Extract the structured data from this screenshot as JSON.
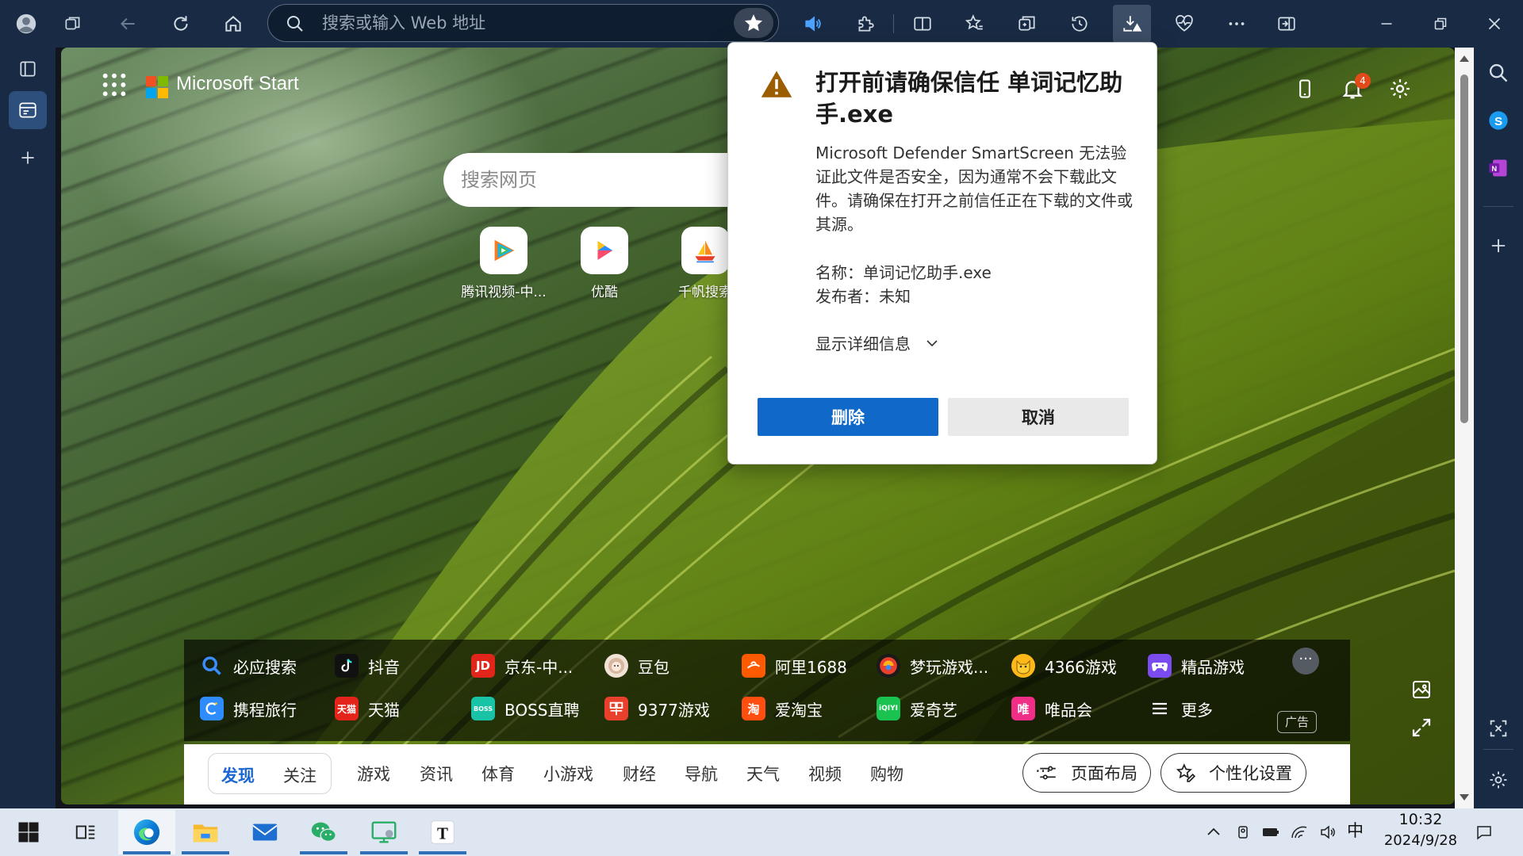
{
  "browser": {
    "address_placeholder": "搜索或输入 Web 地址",
    "accent_color": "#192b44"
  },
  "newtab": {
    "brand": "Microsoft Start",
    "search_placeholder": "搜索网页",
    "quick_links": [
      {
        "label": "腾讯视频-中...",
        "icon": "tencent-video-icon"
      },
      {
        "label": "优酷",
        "icon": "youku-icon"
      },
      {
        "label": "千帆搜索",
        "icon": "qianfan-icon"
      }
    ],
    "notifications_count": "4",
    "links_row1": [
      "必应搜索",
      "抖音",
      "京东-中...",
      "豆包",
      "阿里1688",
      "梦玩游戏...",
      "4366游戏",
      "精品游戏"
    ],
    "links_row2": [
      "携程旅行",
      "天猫",
      "BOSS直聘",
      "9377游戏",
      "爱淘宝",
      "爱奇艺",
      "唯品会",
      "更多"
    ],
    "ad_label": "广告",
    "more_dots": "···",
    "tabs": {
      "discover": "发现",
      "follow": "关注"
    },
    "categories": [
      "游戏",
      "资讯",
      "体育",
      "小游戏",
      "财经",
      "导航",
      "天气",
      "视频",
      "购物"
    ],
    "cat_more": "···",
    "layout_button": "页面布局",
    "personalize_button": "个性化设置"
  },
  "dialog": {
    "title": "打开前请确保信任 单词记忆助手.exe",
    "body": "Microsoft Defender SmartScreen 无法验证此文件是否安全，因为通常不会下载此文件。请确保在打开之前信任正在下载的文件或其源。",
    "name_line": "名称：单词记忆助手.exe",
    "publisher_line": "发布者：未知",
    "details_toggle": "显示详细信息",
    "delete_button": "删除",
    "cancel_button": "取消"
  },
  "taskbar": {
    "ime": "中",
    "time": "10:32",
    "date": "2024/9/28"
  }
}
